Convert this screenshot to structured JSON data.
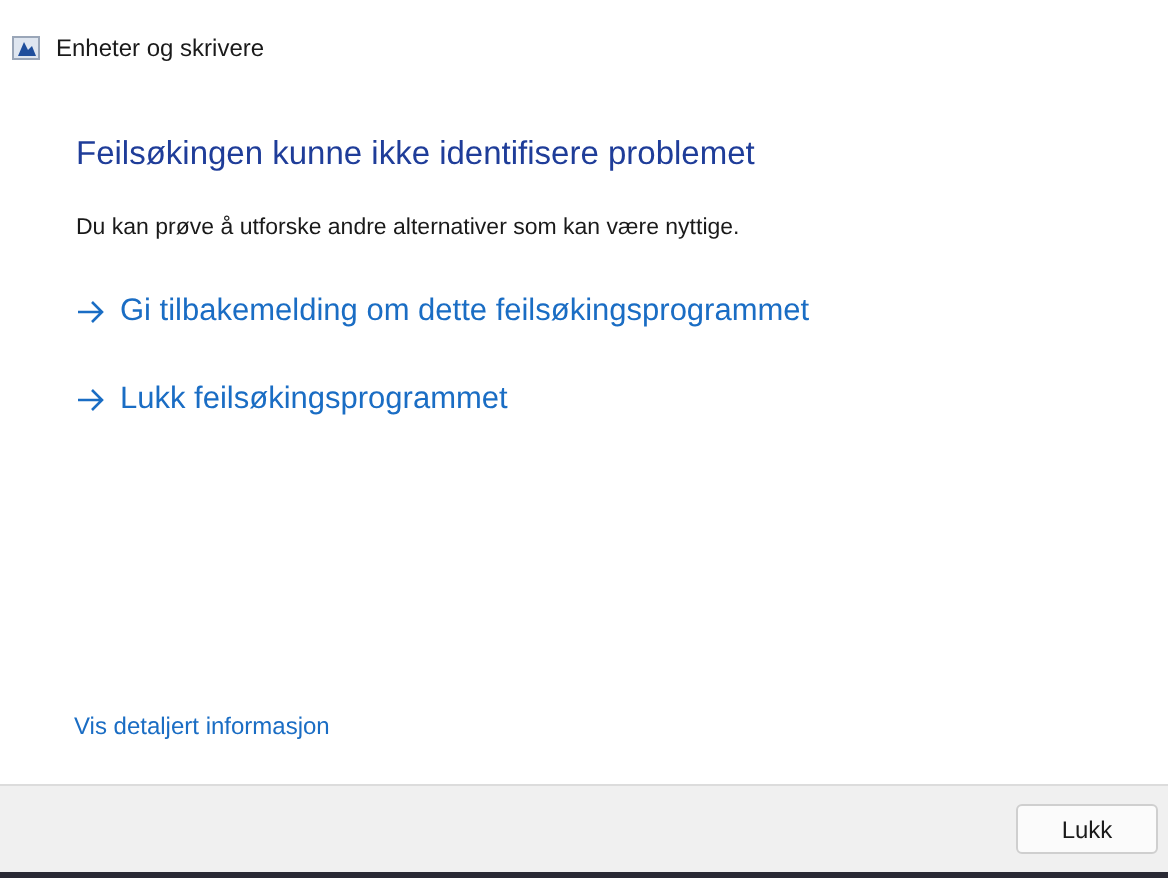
{
  "window": {
    "title": "Enheter og skrivere"
  },
  "heading": "Feilsøkingen kunne ikke identifisere problemet",
  "description": "Du kan prøve å utforske andre alternativer som kan være nyttige.",
  "options": [
    {
      "label": "Gi tilbakemelding om dette feilsøkingsprogrammet"
    },
    {
      "label": "Lukk feilsøkingsprogrammet"
    }
  ],
  "details_link": "Vis detaljert informasjon",
  "buttons": [
    "Lukk"
  ]
}
